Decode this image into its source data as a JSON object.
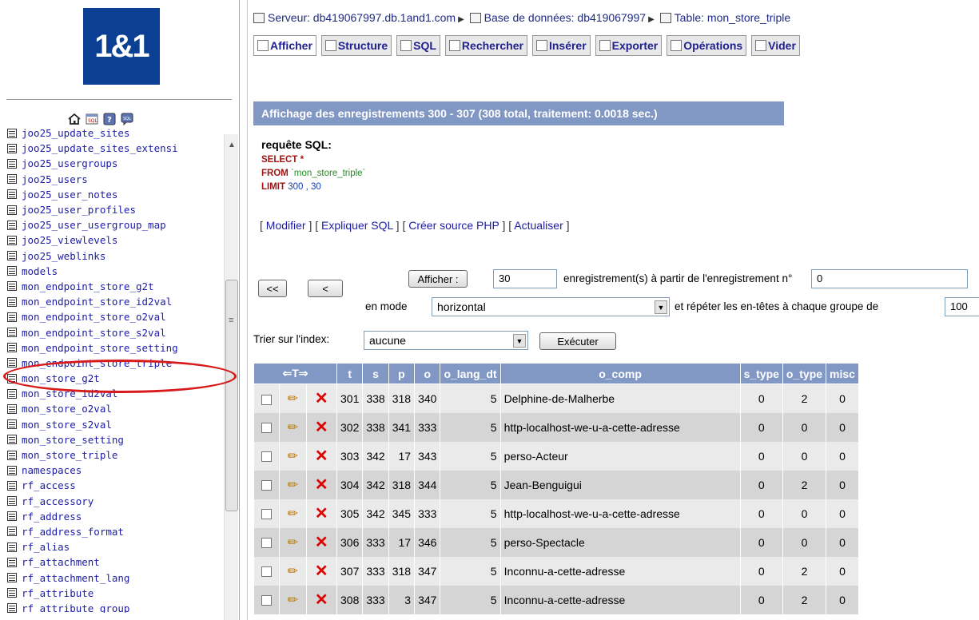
{
  "left": {
    "logo_text": "1&1",
    "icons": [
      "home-icon",
      "sql-icon",
      "help-icon",
      "docs-icon"
    ],
    "tables": [
      "joo25_update_sites",
      "joo25_update_sites_extensi",
      "joo25_usergroups",
      "joo25_users",
      "joo25_user_notes",
      "joo25_user_profiles",
      "joo25_user_usergroup_map",
      "joo25_viewlevels",
      "joo25_weblinks",
      "models",
      "mon_endpoint_store_g2t",
      "mon_endpoint_store_id2val",
      "mon_endpoint_store_o2val",
      "mon_endpoint_store_s2val",
      "mon_endpoint_store_setting",
      "mon_endpoint_store_triple",
      "mon_store_g2t",
      "mon_store_id2val",
      "mon_store_o2val",
      "mon_store_s2val",
      "mon_store_setting",
      "mon_store_triple",
      "namespaces",
      "rf_access",
      "rf_accessory",
      "rf_address",
      "rf_address_format",
      "rf_alias",
      "rf_attachment",
      "rf_attachment_lang",
      "rf_attribute",
      "rf_attribute_group"
    ]
  },
  "breadcrumb": {
    "server_label": "Serveur: db419067997.db.1and1.com",
    "db_label": "Base de données: db419067997",
    "table_label": "Table: mon_store_triple"
  },
  "tabs": [
    "Afficher",
    "Structure",
    "SQL",
    "Rechercher",
    "Insérer",
    "Exporter",
    "Opérations",
    "Vider"
  ],
  "result": {
    "heading": "Affichage des enregistrements 300 - 307 (308 total, traitement: 0.0018 sec.)",
    "sql_label": "requête SQL:",
    "sql_select": "SELECT",
    "sql_star": " *",
    "sql_from": "FROM",
    "sql_table": " `mon_store_triple`",
    "sql_limit": "LIMIT",
    "sql_limit_vals": " 300 , 30",
    "links": [
      "Modifier",
      "Expliquer SQL",
      "Créer source PHP",
      "Actualiser"
    ]
  },
  "nav": {
    "first_label": "<<",
    "prev_label": "<",
    "show_label": "Afficher :",
    "rows_value": "30",
    "from_text": "enregistrement(s) à partir de l'enregistrement n°",
    "start_value": "0",
    "mode_text": "en mode",
    "mode_value": "horizontal",
    "repeat_text": "et répéter les en-têtes à chaque groupe de",
    "repeat_value": "100",
    "sort_label": "Trier sur l'index:",
    "sort_value": "aucune",
    "exec_label": "Exécuter"
  },
  "grid": {
    "arrows": "⇐T⇒",
    "columns": [
      "t",
      "s",
      "p",
      "o",
      "o_lang_dt",
      "o_comp",
      "s_type",
      "o_type",
      "misc"
    ],
    "rows": [
      [
        "301",
        "338",
        "318",
        "340",
        "5",
        "Delphine-de-Malherbe",
        "0",
        "2",
        "0"
      ],
      [
        "302",
        "338",
        "341",
        "333",
        "5",
        "http-localhost-we-u-a-cette-adresse",
        "0",
        "0",
        "0"
      ],
      [
        "303",
        "342",
        "17",
        "343",
        "5",
        "perso-Acteur",
        "0",
        "0",
        "0"
      ],
      [
        "304",
        "342",
        "318",
        "344",
        "5",
        "Jean-Benguigui",
        "0",
        "2",
        "0"
      ],
      [
        "305",
        "342",
        "345",
        "333",
        "5",
        "http-localhost-we-u-a-cette-adresse",
        "0",
        "0",
        "0"
      ],
      [
        "306",
        "333",
        "17",
        "346",
        "5",
        "perso-Spectacle",
        "0",
        "0",
        "0"
      ],
      [
        "307",
        "333",
        "318",
        "347",
        "5",
        "Inconnu-a-cette-adresse",
        "0",
        "2",
        "0"
      ],
      [
        "308",
        "333",
        "3",
        "347",
        "5",
        "Inconnu-a-cette-adresse",
        "0",
        "2",
        "0"
      ]
    ]
  },
  "colors": {
    "header_bg": "#8197c4",
    "link": "#1c1ca8",
    "highlight": "#d81a1a",
    "row_light": "#eaeaea",
    "row_dark": "#d5d5d5"
  }
}
